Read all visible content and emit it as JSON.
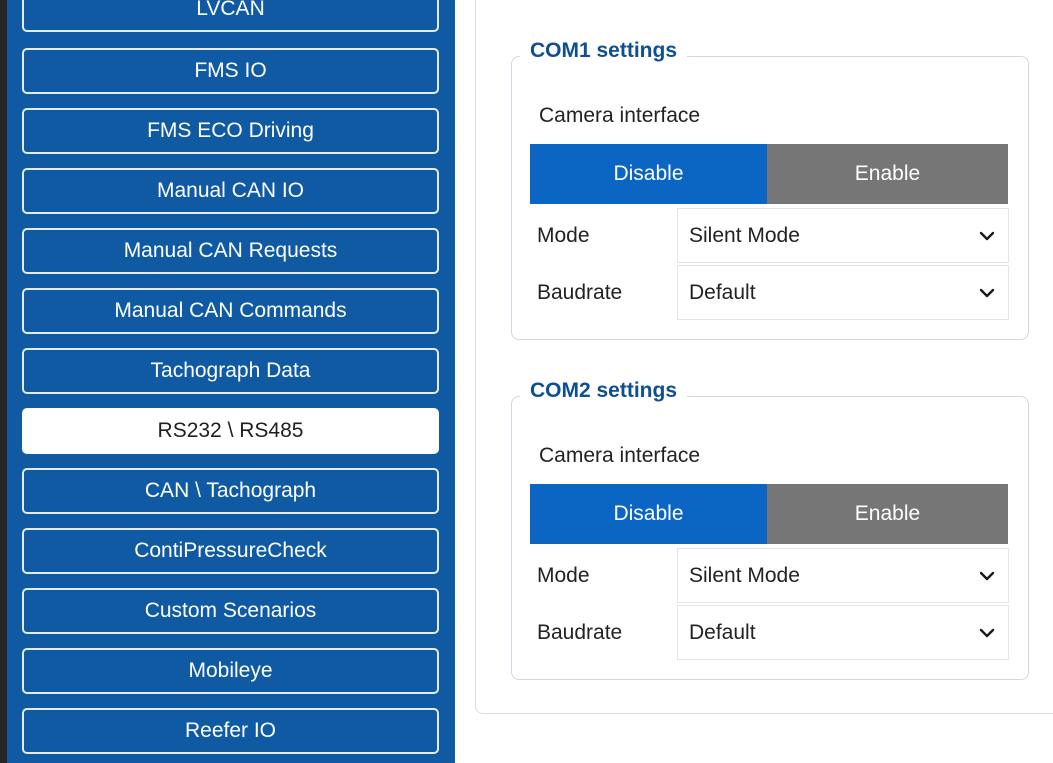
{
  "sidebar": {
    "items": [
      {
        "label": "LVCAN",
        "active": false
      },
      {
        "label": "FMS IO",
        "active": false
      },
      {
        "label": "FMS ECO Driving",
        "active": false
      },
      {
        "label": "Manual CAN IO",
        "active": false
      },
      {
        "label": "Manual CAN Requests",
        "active": false
      },
      {
        "label": "Manual CAN Commands",
        "active": false
      },
      {
        "label": "Tachograph Data",
        "active": false
      },
      {
        "label": "RS232 \\ RS485",
        "active": true
      },
      {
        "label": "CAN \\ Tachograph",
        "active": false
      },
      {
        "label": "ContiPressureCheck",
        "active": false
      },
      {
        "label": "Custom Scenarios",
        "active": false
      },
      {
        "label": "Mobileye",
        "active": false
      },
      {
        "label": "Reefer IO",
        "active": false
      }
    ]
  },
  "com1": {
    "title": "COM1 settings",
    "interface_label": "Camera interface",
    "disable_label": "Disable",
    "enable_label": "Enable",
    "selected": "Disable",
    "mode_label": "Mode",
    "mode_value": "Silent Mode",
    "baudrate_label": "Baudrate",
    "baudrate_value": "Default"
  },
  "com2": {
    "title": "COM2 settings",
    "interface_label": "Camera interface",
    "disable_label": "Disable",
    "enable_label": "Enable",
    "selected": "Disable",
    "mode_label": "Mode",
    "mode_value": "Silent Mode",
    "baudrate_label": "Baudrate",
    "baudrate_value": "Default"
  },
  "icons": {
    "dropdown": "chevron-down-icon"
  },
  "colors": {
    "sidebar_bg": "#0f5aa3",
    "active_item_bg": "#ffffff",
    "selected_toggle": "#0a66c2",
    "unselected_toggle": "#767676",
    "group_title": "#0d4f94"
  }
}
